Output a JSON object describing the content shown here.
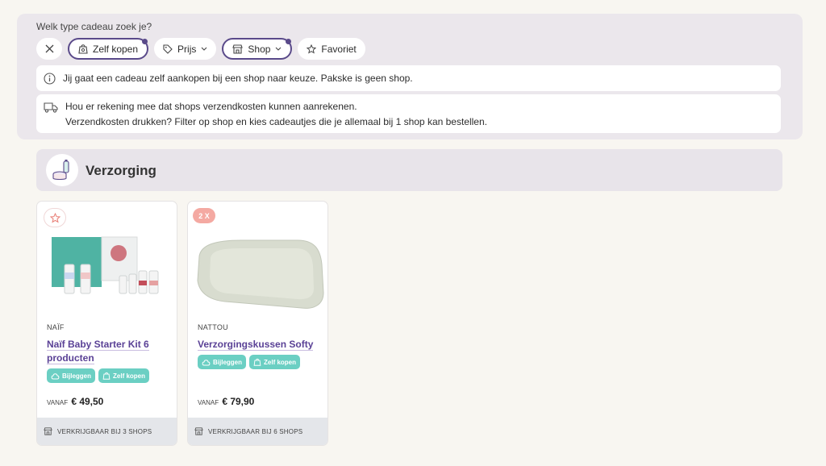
{
  "filters": {
    "question": "Welk type cadeau zoek je?",
    "chips": [
      {
        "label": "Zelf kopen"
      },
      {
        "label": "Prijs"
      },
      {
        "label": "Shop"
      },
      {
        "label": "Favoriet"
      }
    ],
    "info_messages": [
      "Jij gaat een cadeau zelf aankopen bij een shop naar keuze. Pakske is geen shop.",
      "Hou er rekening mee dat shops verzendkosten kunnen aanrekenen.",
      "Verzendkosten drukken? Filter op shop en kies cadeautjes die je allemaal bij 1 shop kan bestellen."
    ]
  },
  "category": {
    "title": "Verzorging",
    "icon": "baby-care-icon"
  },
  "products": [
    {
      "brand": "NAÏF",
      "name": "Naïf Baby Starter Kit 6 producten",
      "tags": [
        "Bijleggen",
        "Zelf kopen"
      ],
      "price_prefix": "VANAF",
      "price": "€ 49,50",
      "shops": "VERKRIJGBAAR BIJ 3 SHOPS"
    },
    {
      "badge": "2 X",
      "brand": "NATTOU",
      "name": "Verzorgingskussen Softy",
      "tags": [
        "Bijleggen",
        "Zelf kopen"
      ],
      "price_prefix": "VANAF",
      "price": "€ 79,90",
      "shops": "VERKRIJGBAAR BIJ 6 SHOPS"
    }
  ],
  "colors": {
    "accent": "#5a4a8a",
    "tag": "#6bcfc3",
    "product_link": "#5a4196",
    "badge": "#f4a9a2"
  }
}
